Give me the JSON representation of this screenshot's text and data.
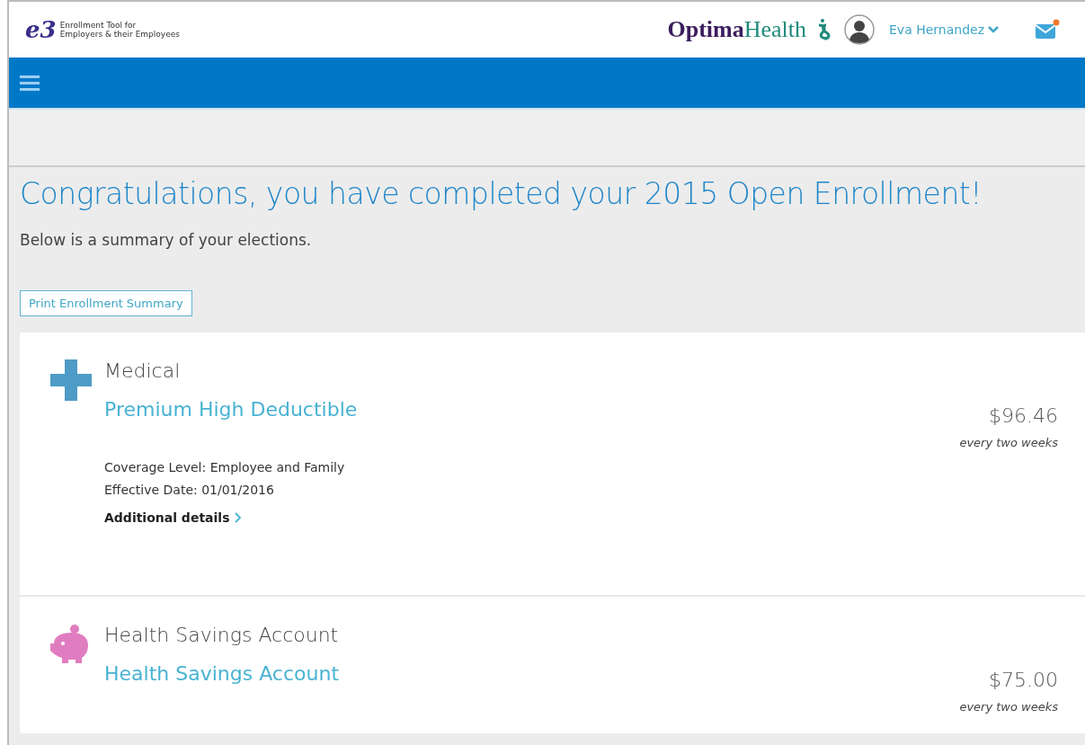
{
  "header": {
    "logo_mark": "e3",
    "logo_text": [
      "Enrollment Tool for",
      "Employers & their Employees"
    ],
    "brand": {
      "first": "Optima",
      "second": "Health"
    },
    "user": "Eva Hernandez",
    "mail": {
      "has_notification": true
    }
  },
  "title": "Congratulations, you have completed your 2015 Open Enrollment!",
  "subtitle": "Below is a summary of your elections.",
  "print_button": "Print Enrollment Summary",
  "elections": [
    {
      "kind": "medical",
      "category": "Medical",
      "plan": "Premium High Deductible",
      "price": "$96.46",
      "frequency": "every two weeks",
      "details": [
        "Coverage Level: Employee and Family",
        "Effective Date: 01/01/2016"
      ],
      "link": "Additional details"
    },
    {
      "kind": "savings",
      "category": "Health Savings Account",
      "plan": "Health Savings Account",
      "price": "$75.00",
      "frequency": "every two weeks"
    }
  ]
}
